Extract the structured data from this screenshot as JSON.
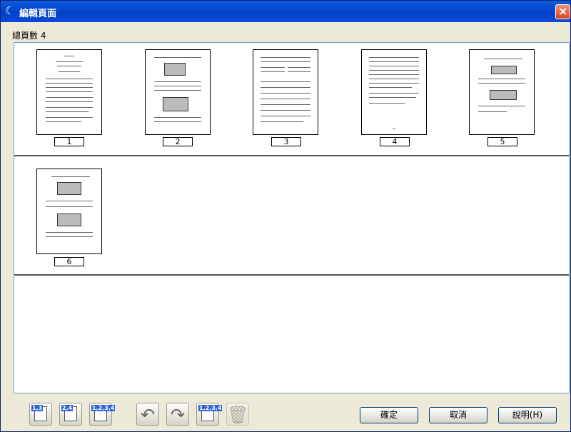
{
  "window": {
    "title": "編輯頁面"
  },
  "info": {
    "page_count_label": "總頁數",
    "page_count_value": "4"
  },
  "pages": [
    {
      "number": "1"
    },
    {
      "number": "2"
    },
    {
      "number": "3"
    },
    {
      "number": "4"
    },
    {
      "number": "5"
    },
    {
      "number": "6"
    }
  ],
  "toolbar": {
    "odd_pages_badge": "1,3",
    "even_pages_badge": "2,4",
    "all_pages_badge": "1,2,3,4",
    "reorder_badge": "1,2,3,4"
  },
  "buttons": {
    "ok_label": "確定",
    "cancel_label": "取消",
    "help_label": "說明(H)"
  },
  "colors": {
    "title_bar": "#0340c8",
    "close_button": "#d8431d",
    "dialog_face": "#ece9d8"
  }
}
